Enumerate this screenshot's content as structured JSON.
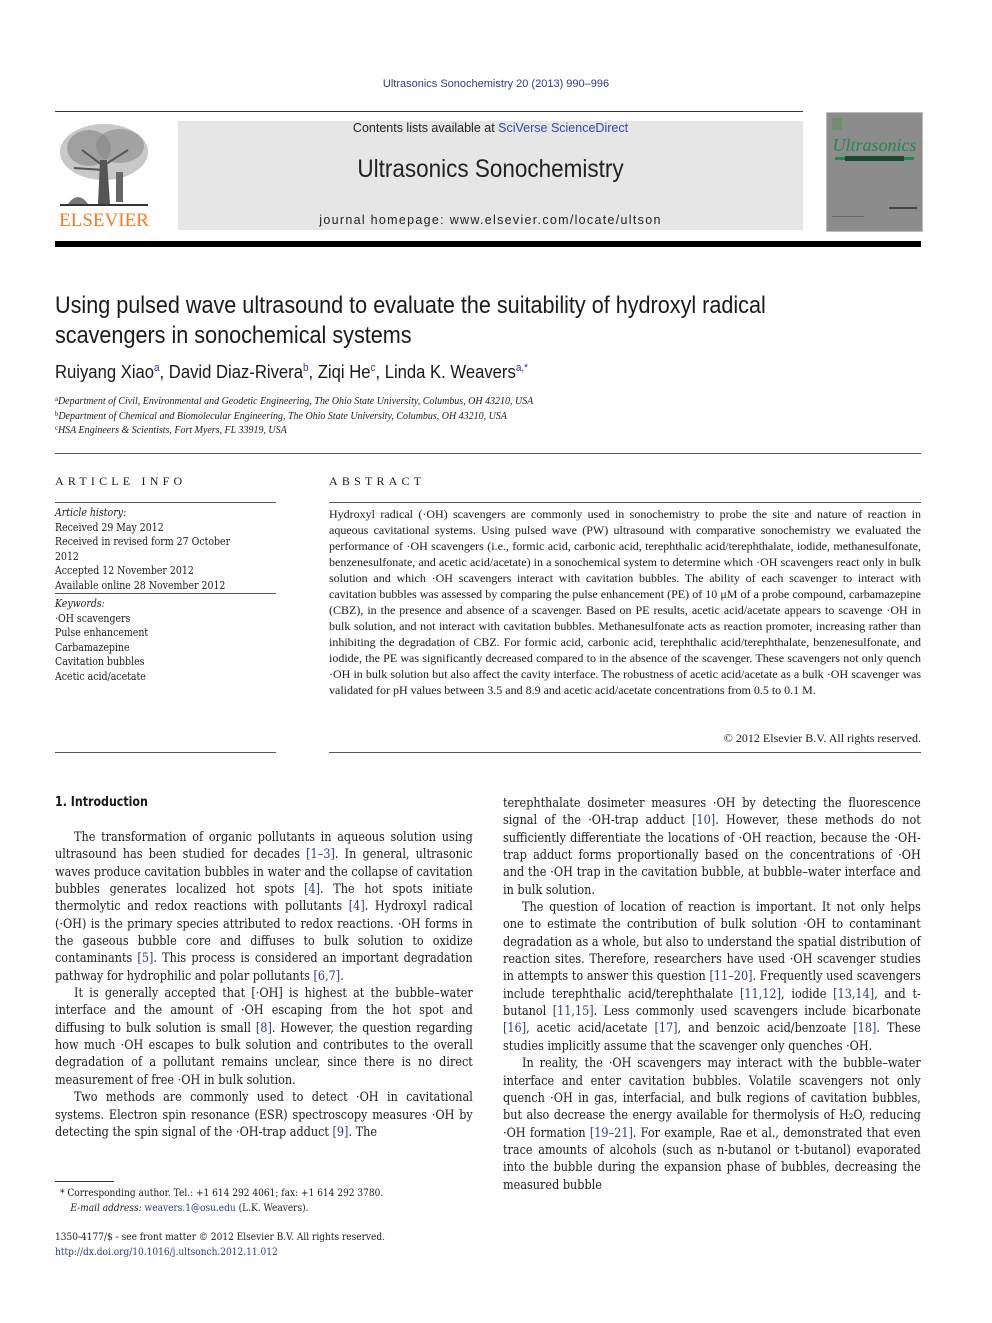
{
  "header": {
    "citation": "Ultrasonics Sonochemistry 20 (2013) 990–996",
    "contents_prefix": "Contents lists available at ",
    "contents_link": "SciVerse ScienceDirect",
    "journal_title": "Ultrasonics Sonochemistry",
    "homepage": "journal homepage: www.elsevier.com/locate/ultson",
    "publisher_logo_text": "ELSEVIER",
    "cover_title": "Ultrasonics",
    "colors": {
      "publisher_orange": "#f47b20",
      "link_blue": "#2b3a8c",
      "cover_green": "#1f8a4c"
    }
  },
  "article": {
    "title": "Using pulsed wave ultrasound to evaluate the suitability of hydroxyl radical scavengers in sonochemical systems",
    "authors": [
      {
        "name": "Ruiyang Xiao",
        "sup": "a"
      },
      {
        "name": "David Diaz-Rivera",
        "sup": "b"
      },
      {
        "name": "Ziqi He",
        "sup": "c"
      },
      {
        "name": "Linda K. Weavers",
        "sup": "a,*"
      }
    ],
    "affiliations": [
      {
        "sup": "a",
        "text": "Department of Civil, Environmental and Geodetic Engineering, The Ohio State University, Columbus, OH 43210, USA"
      },
      {
        "sup": "b",
        "text": "Department of Chemical and Biomolecular Engineering, The Ohio State University, Columbus, OH 43210, USA"
      },
      {
        "sup": "c",
        "text": "HSA Engineers & Scientists, Fort Myers, FL 33919, USA"
      }
    ]
  },
  "article_info": {
    "heading": "ARTICLE INFO",
    "history_label": "Article history:",
    "history": [
      "Received 29 May 2012",
      "Received in revised form 27 October 2012",
      "Accepted 12 November 2012",
      "Available online 28 November 2012"
    ],
    "keywords_label": "Keywords:",
    "keywords": [
      "·OH scavengers",
      "Pulse enhancement",
      "Carbamazepine",
      "Cavitation bubbles",
      "Acetic acid/acetate"
    ]
  },
  "abstract": {
    "heading": "ABSTRACT",
    "text": "Hydroxyl radical (·OH) scavengers are commonly used in sonochemistry to probe the site and nature of reaction in aqueous cavitational systems. Using pulsed wave (PW) ultrasound with comparative sonochemistry we evaluated the performance of ·OH scavengers (i.e., formic acid, carbonic acid, terephthalic acid/terephthalate, iodide, methanesulfonate, benzenesulfonate, and acetic acid/acetate) in a sonochemical system to determine which ·OH scavengers react only in bulk solution and which ·OH scavengers interact with cavitation bubbles. The ability of each scavenger to interact with cavitation bubbles was assessed by comparing the pulse enhancement (PE) of 10 μM of a probe compound, carbamazepine (CBZ), in the presence and absence of a scavenger. Based on PE results, acetic acid/acetate appears to scavenge ·OH in bulk solution, and not interact with cavitation bubbles. Methanesulfonate acts as reaction promoter, increasing rather than inhibiting the degradation of CBZ. For formic acid, carbonic acid, terephthalic acid/terephthalate, benzenesulfonate, and iodide, the PE was significantly decreased compared to in the absence of the scavenger. These scavengers not only quench ·OH in bulk solution but also affect the cavity interface. The robustness of acetic acid/acetate as a bulk ·OH scavenger was validated for pH values between 3.5 and 8.9 and acetic acid/acetate concentrations from 0.5 to 0.1 M.",
    "copyright": "© 2012 Elsevier B.V. All rights reserved."
  },
  "body": {
    "intro_heading": "1. Introduction",
    "left_paragraphs": [
      [
        {
          "t": "The transformation of organic pollutants in aqueous solution using ultrasound has been studied for decades "
        },
        {
          "r": "[1–3]"
        },
        {
          "t": ". In general, ultrasonic waves produce cavitation bubbles in water and the collapse of cavitation bubbles generates localized hot spots "
        },
        {
          "r": "[4]"
        },
        {
          "t": ". The hot spots initiate thermolytic and redox reactions with pollutants "
        },
        {
          "r": "[4]"
        },
        {
          "t": ". Hydroxyl radical (·OH) is the primary species attributed to redox reactions. ·OH forms in the gaseous bubble core and diffuses to bulk solution to oxidize contaminants "
        },
        {
          "r": "[5]"
        },
        {
          "t": ". This process is considered an important degradation pathway for hydrophilic and polar pollutants "
        },
        {
          "r": "[6,7]"
        },
        {
          "t": "."
        }
      ],
      [
        {
          "t": "It is generally accepted that [·OH] is highest at the bubble–water interface and the amount of ·OH escaping from the hot spot and diffusing to bulk solution is small "
        },
        {
          "r": "[8]"
        },
        {
          "t": ". However, the question regarding how much ·OH escapes to bulk solution and contributes to the overall degradation of a pollutant remains unclear, since there is no direct measurement of free ·OH in bulk solution."
        }
      ],
      [
        {
          "t": "Two methods are commonly used to detect ·OH in cavitational systems. Electron spin resonance (ESR) spectroscopy measures ·OH by detecting the spin signal of the ·OH-trap adduct "
        },
        {
          "r": "[9]"
        },
        {
          "t": ". The"
        }
      ]
    ],
    "right_paragraphs": [
      [
        {
          "t": "terephthalate dosimeter measures ·OH by detecting the fluorescence signal of the ·OH-trap adduct "
        },
        {
          "r": "[10]"
        },
        {
          "t": ". However, these methods do not sufficiently differentiate the locations of ·OH reaction, because the ·OH-trap adduct forms proportionally based on the concentrations of ·OH and the ·OH trap in the cavitation bubble, at bubble–water interface and in bulk solution."
        }
      ],
      [
        {
          "t": "The question of location of reaction is important. It not only helps one to estimate the contribution of bulk solution ·OH to contaminant degradation as a whole, but also to understand the spatial distribution of reaction sites. Therefore, researchers have used ·OH scavenger studies in attempts to answer this question "
        },
        {
          "r": "[11–20]"
        },
        {
          "t": ". Frequently used scavengers include terephthalic acid/terephthalate "
        },
        {
          "r": "[11,12]"
        },
        {
          "t": ", iodide "
        },
        {
          "r": "[13,14]"
        },
        {
          "t": ", and t-butanol "
        },
        {
          "r": "[11,15]"
        },
        {
          "t": ". Less commonly used scavengers include bicarbonate "
        },
        {
          "r": "[16]"
        },
        {
          "t": ", acetic acid/acetate "
        },
        {
          "r": "[17]"
        },
        {
          "t": ", and benzoic acid/benzoate "
        },
        {
          "r": "[18]"
        },
        {
          "t": ". These studies implicitly assume that the scavenger only quenches ·OH."
        }
      ],
      [
        {
          "t": "In reality, the ·OH scavengers may interact with the bubble–water interface and enter cavitation bubbles. Volatile scavengers not only quench ·OH in gas, interfacial, and bulk regions of cavitation bubbles, but also decrease the energy available for thermolysis of H₂O, reducing ·OH formation "
        },
        {
          "r": "[19–21]"
        },
        {
          "t": ". For example, Rae et al., demonstrated that even trace amounts of alcohols (such as n-butanol or t-butanol) evaporated into the bubble during the expansion phase of bubbles, decreasing the measured bubble"
        }
      ]
    ]
  },
  "footnote": {
    "corresponding": "* Corresponding author. Tel.: +1 614 292 4061; fax: +1 614 292 3780.",
    "email_label": "E-mail address: ",
    "email": "weavers.1@osu.edu",
    "email_suffix": " (L.K. Weavers)."
  },
  "front_matter": {
    "issn_line": "1350-4177/$ - see front matter © 2012 Elsevier B.V. All rights reserved.",
    "doi": "http://dx.doi.org/10.1016/j.ultsonch.2012.11.012"
  }
}
